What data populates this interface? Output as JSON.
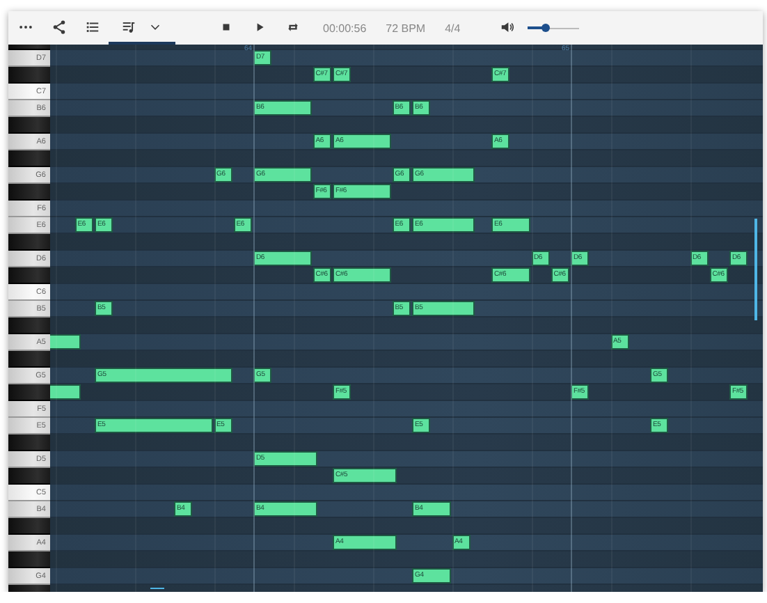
{
  "toolbar": {
    "buttons": [
      {
        "kind": "more",
        "selected": false,
        "dropdown": false
      },
      {
        "kind": "share",
        "selected": false,
        "dropdown": false
      },
      {
        "kind": "list",
        "selected": false,
        "dropdown": false
      },
      {
        "kind": "playlist",
        "selected": true,
        "dropdown": true
      }
    ],
    "transport": [
      {
        "kind": "stop"
      },
      {
        "kind": "play"
      },
      {
        "kind": "repeat"
      }
    ],
    "time": "00:00:56",
    "tempo": "72 BPM",
    "meter": "4/4",
    "volume": {
      "level": 0.36
    }
  },
  "roll": {
    "bars": [
      {
        "label": "64"
      },
      {
        "label": "65"
      }
    ],
    "rows": [
      {
        "kind": "black",
        "notes": []
      },
      {
        "kind": "white",
        "label": "D7",
        "accent": false,
        "notes": [
          {
            "label": "D7"
          }
        ]
      },
      {
        "kind": "black",
        "notes": [
          {
            "label": "C#7"
          },
          {
            "label": "C#7"
          },
          {
            "label": "C#7"
          }
        ]
      },
      {
        "kind": "white",
        "label": "C7",
        "accent": true,
        "notes": []
      },
      {
        "kind": "white",
        "label": "B6",
        "accent": false,
        "notes": [
          {
            "label": "B6"
          },
          {
            "label": "B6"
          },
          {
            "label": "B6"
          }
        ]
      },
      {
        "kind": "black",
        "notes": []
      },
      {
        "kind": "white",
        "label": "A6",
        "accent": false,
        "notes": [
          {
            "label": "A6"
          },
          {
            "label": "A6"
          },
          {
            "label": "A6"
          }
        ]
      },
      {
        "kind": "black",
        "notes": []
      },
      {
        "kind": "white",
        "label": "G6",
        "accent": false,
        "notes": [
          {
            "label": "G6"
          },
          {
            "label": "G6"
          },
          {
            "label": "G6"
          },
          {
            "label": "G6"
          }
        ]
      },
      {
        "kind": "black",
        "notes": [
          {
            "label": "F#6"
          },
          {
            "label": "F#6"
          }
        ]
      },
      {
        "kind": "white",
        "label": "F6",
        "accent": false,
        "notes": []
      },
      {
        "kind": "white",
        "label": "E6",
        "accent": false,
        "notes": [
          {
            "label": "E6"
          },
          {
            "label": "E6"
          },
          {
            "label": "E6"
          },
          {
            "label": "E6"
          },
          {
            "label": "E6"
          },
          {
            "label": "E6"
          }
        ]
      },
      {
        "kind": "black",
        "notes": []
      },
      {
        "kind": "white",
        "label": "D6",
        "accent": false,
        "notes": [
          {
            "label": "D6"
          },
          {
            "label": "D6"
          },
          {
            "label": "D6"
          },
          {
            "label": "D6"
          },
          {
            "label": "D6"
          }
        ]
      },
      {
        "kind": "black",
        "notes": [
          {
            "label": "C#6"
          },
          {
            "label": "C#6"
          },
          {
            "label": "C#6"
          },
          {
            "label": "C#6"
          },
          {
            "label": "C#6"
          }
        ]
      },
      {
        "kind": "white",
        "label": "C6",
        "accent": true,
        "notes": []
      },
      {
        "kind": "white",
        "label": "B5",
        "accent": false,
        "notes": [
          {
            "label": "B5"
          },
          {
            "label": "B5"
          },
          {
            "label": "B5"
          }
        ]
      },
      {
        "kind": "black",
        "notes": []
      },
      {
        "kind": "white",
        "label": "A5",
        "accent": false,
        "notes": [
          {
            "clipped": true
          },
          {
            "label": "A5",
            "clipped": false
          }
        ]
      },
      {
        "kind": "black",
        "notes": []
      },
      {
        "kind": "white",
        "label": "G5",
        "accent": false,
        "notes": [
          {
            "label": "G5"
          },
          {
            "label": "G5"
          },
          {
            "label": "G5"
          }
        ]
      },
      {
        "kind": "black",
        "notes": [
          {
            "clipped": true
          },
          {
            "label": "F#5",
            "clipped": false
          },
          {
            "label": "F#5",
            "clipped": false
          },
          {
            "label": "F#5",
            "clipped": false
          }
        ]
      },
      {
        "kind": "white",
        "label": "F5",
        "accent": false,
        "notes": []
      },
      {
        "kind": "white",
        "label": "E5",
        "accent": false,
        "notes": [
          {
            "label": "E5"
          },
          {
            "label": "E5"
          },
          {
            "label": "E5"
          },
          {
            "label": "E5"
          }
        ]
      },
      {
        "kind": "black",
        "notes": []
      },
      {
        "kind": "white",
        "label": "D5",
        "accent": false,
        "notes": [
          {
            "label": "D5"
          }
        ]
      },
      {
        "kind": "black",
        "notes": [
          {
            "label": "C#5"
          }
        ]
      },
      {
        "kind": "white",
        "label": "C5",
        "accent": true,
        "notes": []
      },
      {
        "kind": "white",
        "label": "B4",
        "accent": false,
        "notes": [
          {
            "label": "B4"
          },
          {
            "label": "B4"
          },
          {
            "label": "B4"
          }
        ]
      },
      {
        "kind": "black",
        "notes": []
      },
      {
        "kind": "white",
        "label": "A4",
        "accent": false,
        "notes": [
          {
            "label": "A4"
          },
          {
            "label": "A4"
          }
        ]
      },
      {
        "kind": "black",
        "notes": []
      },
      {
        "kind": "white",
        "label": "G4",
        "accent": false,
        "notes": [
          {
            "label": "G4"
          }
        ]
      },
      {
        "kind": "black",
        "notes": []
      }
    ]
  }
}
